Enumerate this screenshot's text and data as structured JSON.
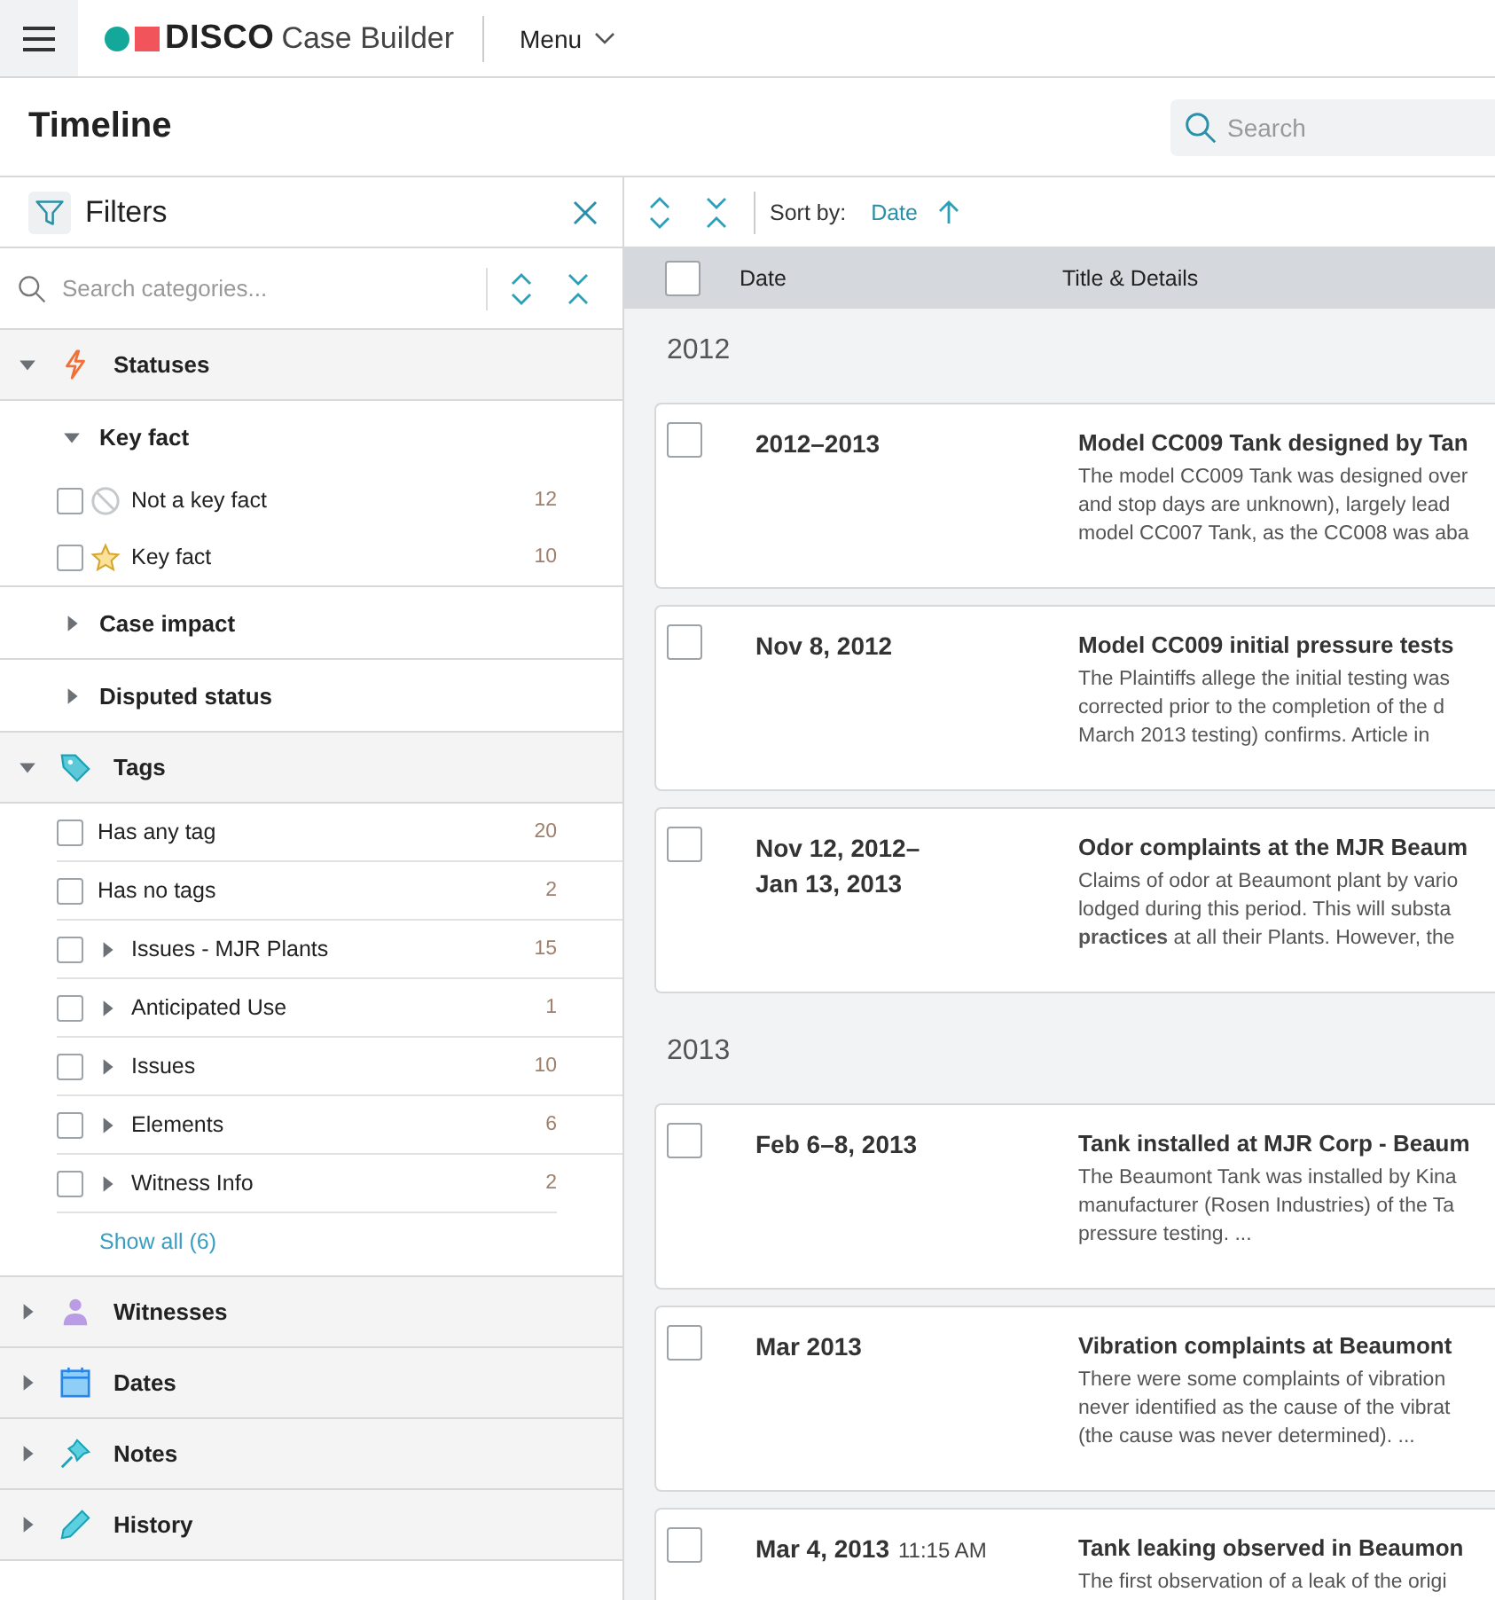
{
  "header": {
    "brand": "DISCO",
    "product": "Case Builder",
    "menu": "Menu"
  },
  "page": {
    "title": "Timeline",
    "search_placeholder": "Search"
  },
  "toolbar": {
    "sort_label": "Sort by:",
    "sort_value": "Date",
    "sort_ascending": true
  },
  "sidebar": {
    "title": "Filters",
    "search_placeholder": "Search categories...",
    "sections": [
      {
        "kind": "statuses",
        "label": "Statuses",
        "expanded": true,
        "groups": [
          {
            "label": "Key fact",
            "expanded": true,
            "items": [
              {
                "kind": "not-key",
                "label": "Not a key fact",
                "count": "12",
                "checked": false
              },
              {
                "kind": "key",
                "label": "Key fact",
                "count": "10",
                "checked": false
              }
            ]
          },
          {
            "label": "Case impact",
            "expanded": false
          },
          {
            "label": "Disputed status",
            "expanded": false
          }
        ]
      },
      {
        "kind": "tags",
        "label": "Tags",
        "expanded": true,
        "tag_items": [
          {
            "label": "Has any tag",
            "count": "20",
            "checked": false,
            "expandable": false
          },
          {
            "label": "Has no tags",
            "count": "2",
            "checked": false,
            "expandable": false
          },
          {
            "label": "Issues - MJR Plants",
            "count": "15",
            "checked": false,
            "expandable": true
          },
          {
            "label": "Anticipated Use",
            "count": "1",
            "checked": false,
            "expandable": true
          },
          {
            "label": "Issues",
            "count": "10",
            "checked": false,
            "expandable": true
          },
          {
            "label": "Elements",
            "count": "6",
            "checked": false,
            "expandable": true
          },
          {
            "label": "Witness Info",
            "count": "2",
            "checked": false,
            "expandable": true
          }
        ],
        "show_all": "Show all (6)"
      },
      {
        "kind": "witnesses",
        "label": "Witnesses",
        "expanded": false
      },
      {
        "kind": "dates",
        "label": "Dates",
        "expanded": false
      },
      {
        "kind": "notes",
        "label": "Notes",
        "expanded": false
      },
      {
        "kind": "history",
        "label": "History",
        "expanded": false
      }
    ]
  },
  "table": {
    "columns": [
      "Date",
      "Title & Details"
    ],
    "all_checked": false,
    "years": [
      {
        "year": "2012",
        "events": [
          {
            "checked": false,
            "date": [
              "2012–2013"
            ],
            "title": "Model CC009 Tank designed by Tan",
            "details": [
              "The model CC009 Tank was designed over",
              "and stop days are unknown), largely lead",
              "model CC007 Tank, as the CC008 was aba"
            ]
          },
          {
            "checked": false,
            "date": [
              "Nov 8, 2012"
            ],
            "title": "Model CC009 initial pressure tests",
            "details": [
              "The Plaintiffs allege the initial testing was",
              "corrected prior to the completion of the d",
              "March 2013 testing) confirms.   Article in"
            ]
          },
          {
            "checked": false,
            "date": [
              "Nov 12, 2012–",
              "Jan 13, 2013"
            ],
            "title": "Odor complaints at the MJR Beaum",
            "details": [
              "Claims of odor at Beaumont plant by vario",
              "lodged during this period. This will substa",
              "**practices** at all their Plants. However, the"
            ]
          }
        ]
      },
      {
        "year": "2013",
        "events": [
          {
            "checked": false,
            "date": [
              "Feb 6–8, 2013"
            ],
            "title": "Tank installed at MJR Corp - Beaum",
            "details": [
              "The Beaumont Tank was installed by Kina",
              "manufacturer (Rosen Industries) of the Ta",
              "pressure testing.  ..."
            ]
          },
          {
            "checked": false,
            "date": [
              "Mar 2013"
            ],
            "title": "Vibration complaints at Beaumont",
            "details": [
              "There were some complaints of vibration",
              "never identified as the cause of the vibrat",
              "(the cause was never determined).  ..."
            ]
          },
          {
            "checked": false,
            "date": [
              "Mar 4, 2013"
            ],
            "time": "11:15 AM",
            "title": "Tank leaking observed in Beaumon",
            "details": [
              "The first observation of a leak of the origi"
            ]
          }
        ]
      }
    ]
  }
}
